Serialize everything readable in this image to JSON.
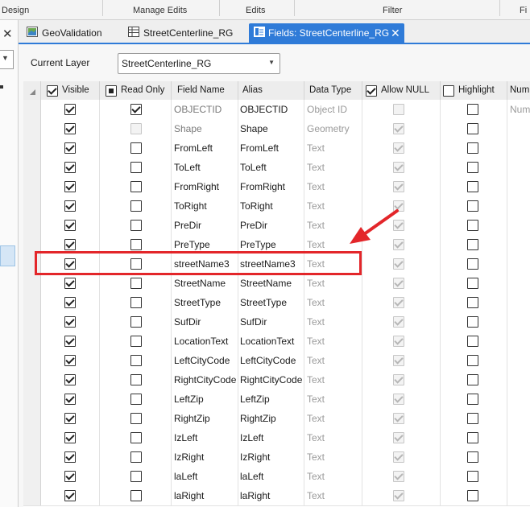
{
  "ribbon": {
    "groups": [
      "Design",
      "Manage Edits",
      "Edits",
      "Filter",
      "Fi"
    ]
  },
  "tabs": [
    {
      "label": "GeoValidation",
      "icon": "map-icon"
    },
    {
      "label": "StreetCenterline_RG",
      "icon": "table-icon"
    },
    {
      "label": "Fields: StreetCenterline_RG",
      "icon": "fields-icon",
      "active": true
    }
  ],
  "current_layer": {
    "label": "Current Layer",
    "value": "StreetCenterline_RG"
  },
  "columns": {
    "visible": "Visible",
    "read_only": "Read Only",
    "field_name": "Field Name",
    "alias": "Alias",
    "data_type": "Data Type",
    "allow_null": "Allow NULL",
    "highlight": "Highlight",
    "number_format": "Num"
  },
  "rows": [
    {
      "field": "OBJECTID",
      "alias": "OBJECTID",
      "type": "Object ID",
      "visible": true,
      "readonly": true,
      "readonly_disabled": false,
      "allownull": false,
      "numfmt": "Num",
      "style": "grey"
    },
    {
      "field": "Shape",
      "alias": "Shape",
      "type": "Geometry",
      "visible": true,
      "readonly": false,
      "readonly_disabled": true,
      "allownull": true,
      "numfmt": "",
      "style": "grey"
    },
    {
      "field": "FromLeft",
      "alias": "FromLeft",
      "type": "Text",
      "visible": true,
      "readonly": false,
      "allownull": true,
      "numfmt": ""
    },
    {
      "field": "ToLeft",
      "alias": "ToLeft",
      "type": "Text",
      "visible": true,
      "readonly": false,
      "allownull": true,
      "numfmt": ""
    },
    {
      "field": "FromRight",
      "alias": "FromRight",
      "type": "Text",
      "visible": true,
      "readonly": false,
      "allownull": true,
      "numfmt": ""
    },
    {
      "field": "ToRight",
      "alias": "ToRight",
      "type": "Text",
      "visible": true,
      "readonly": false,
      "allownull": true,
      "numfmt": ""
    },
    {
      "field": "PreDir",
      "alias": "PreDir",
      "type": "Text",
      "visible": true,
      "readonly": false,
      "allownull": true,
      "numfmt": ""
    },
    {
      "field": "PreType",
      "alias": "PreType",
      "type": "Text",
      "visible": true,
      "readonly": false,
      "allownull": true,
      "numfmt": ""
    },
    {
      "field": "streetName3",
      "alias": "streetName3",
      "type": "Text",
      "visible": true,
      "readonly": false,
      "allownull": true,
      "numfmt": ""
    },
    {
      "field": "StreetName",
      "alias": "StreetName",
      "type": "Text",
      "visible": true,
      "readonly": false,
      "allownull": true,
      "numfmt": ""
    },
    {
      "field": "StreetType",
      "alias": "StreetType",
      "type": "Text",
      "visible": true,
      "readonly": false,
      "allownull": true,
      "numfmt": ""
    },
    {
      "field": "SufDir",
      "alias": "SufDir",
      "type": "Text",
      "visible": true,
      "readonly": false,
      "allownull": true,
      "numfmt": ""
    },
    {
      "field": "LocationText",
      "alias": "LocationText",
      "type": "Text",
      "visible": true,
      "readonly": false,
      "allownull": true,
      "numfmt": ""
    },
    {
      "field": "LeftCityCode",
      "alias": "LeftCityCode",
      "type": "Text",
      "visible": true,
      "readonly": false,
      "allownull": true,
      "numfmt": ""
    },
    {
      "field": "RightCityCode",
      "alias": "RightCityCode",
      "type": "Text",
      "visible": true,
      "readonly": false,
      "allownull": true,
      "numfmt": ""
    },
    {
      "field": "LeftZip",
      "alias": "LeftZip",
      "type": "Text",
      "visible": true,
      "readonly": false,
      "allownull": true,
      "numfmt": ""
    },
    {
      "field": "RightZip",
      "alias": "RightZip",
      "type": "Text",
      "visible": true,
      "readonly": false,
      "allownull": true,
      "numfmt": ""
    },
    {
      "field": "IzLeft",
      "alias": "IzLeft",
      "type": "Text",
      "visible": true,
      "readonly": false,
      "allownull": true,
      "numfmt": ""
    },
    {
      "field": "IzRight",
      "alias": "IzRight",
      "type": "Text",
      "visible": true,
      "readonly": false,
      "allownull": true,
      "numfmt": ""
    },
    {
      "field": "laLeft",
      "alias": "laLeft",
      "type": "Text",
      "visible": true,
      "readonly": false,
      "allownull": true,
      "numfmt": ""
    },
    {
      "field": "laRight",
      "alias": "laRight",
      "type": "Text",
      "visible": true,
      "readonly": false,
      "allownull": true,
      "numfmt": ""
    }
  ],
  "annotation": {
    "color": "#e3262a",
    "highlighted_field": "streetName3"
  },
  "colors": {
    "accent": "#2f7bd8"
  }
}
